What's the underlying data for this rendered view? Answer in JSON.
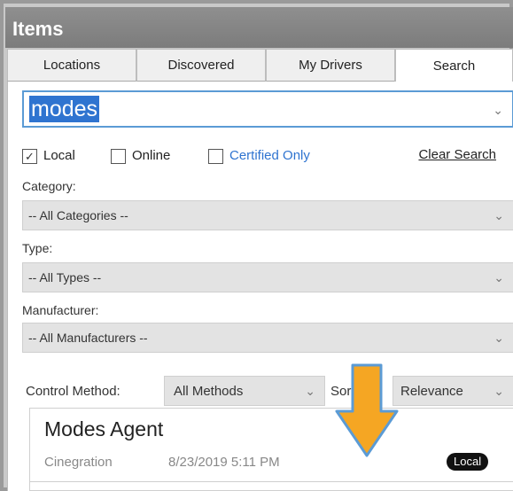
{
  "window": {
    "title": "Items"
  },
  "tabs": [
    {
      "label": "Locations"
    },
    {
      "label": "Discovered"
    },
    {
      "label": "My Drivers"
    },
    {
      "label": "Search"
    }
  ],
  "search": {
    "value": "modes"
  },
  "filters": {
    "local_label": "Local",
    "online_label": "Online",
    "certified_label": "Certified Only",
    "local_checked": true,
    "clear_label": "Clear Search"
  },
  "category": {
    "label": "Category:",
    "value": "-- All Categories --"
  },
  "type": {
    "label": "Type:",
    "value": "-- All Types --"
  },
  "manufacturer": {
    "label": "Manufacturer:",
    "value": "-- All Manufacturers --"
  },
  "control": {
    "label": "Control Method:",
    "value": "All Methods"
  },
  "sort": {
    "label": "Sort",
    "value": "Relevance"
  },
  "result": {
    "title": "Modes Agent",
    "maker": "Cinegration",
    "date": "8/23/2019 5:11 PM",
    "badge": "Local"
  },
  "colors": {
    "accent": "#2f74d0",
    "arrow": "#f5a623",
    "arrow_border": "#5b9bd5"
  },
  "icons": {
    "dropdown": "chevron-down-icon",
    "annotation": "arrow-down-icon"
  }
}
